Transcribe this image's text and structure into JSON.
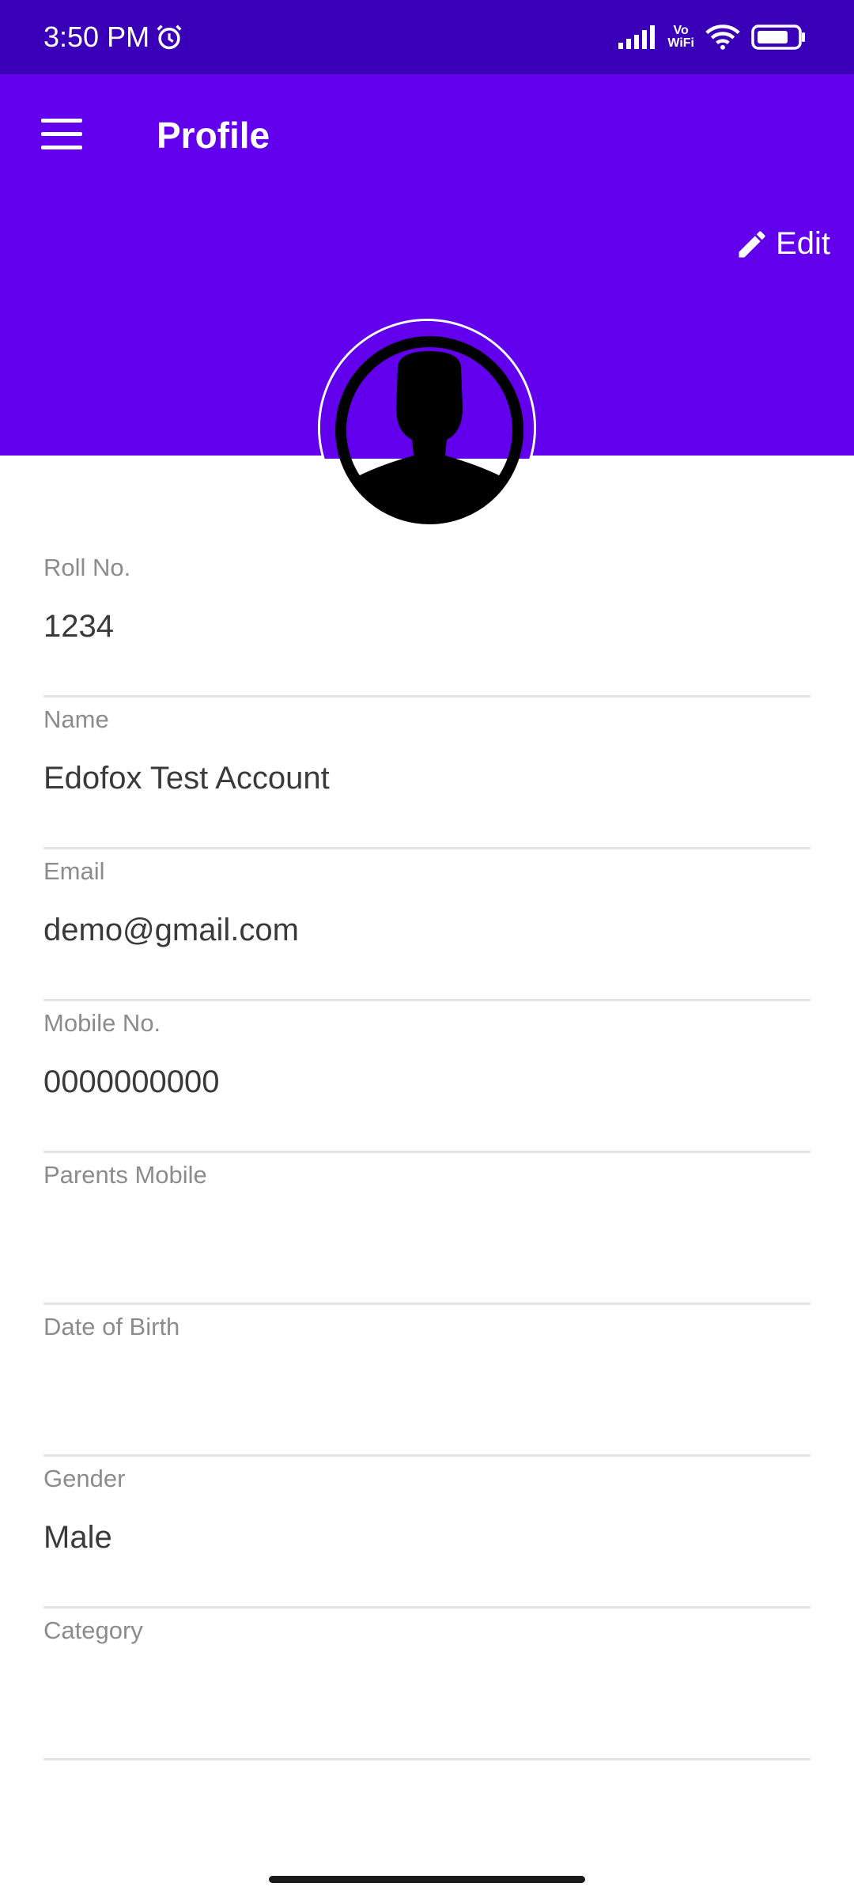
{
  "status_bar": {
    "time": "3:50 PM",
    "icons": [
      "alarm-icon",
      "signal-icon",
      "vowifi-icon",
      "wifi-icon",
      "battery-icon"
    ],
    "vowifi_top": "Vo",
    "vowifi_bottom": "WiFi"
  },
  "app_bar": {
    "title": "Profile",
    "edit_label": "Edit",
    "color": "#6200ee"
  },
  "fields": [
    {
      "label": "Roll No.",
      "value": "1234"
    },
    {
      "label": "Name",
      "value": "Edofox Test Account"
    },
    {
      "label": "Email",
      "value": "demo@gmail.com"
    },
    {
      "label": "Mobile No.",
      "value": "0000000000"
    },
    {
      "label": "Parents Mobile",
      "value": ""
    },
    {
      "label": "Date of Birth",
      "value": ""
    },
    {
      "label": "Gender",
      "value": "Male"
    },
    {
      "label": "Category",
      "value": ""
    }
  ]
}
